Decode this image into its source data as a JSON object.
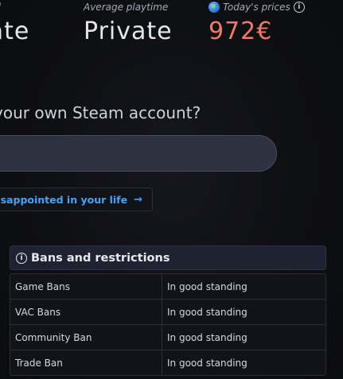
{
  "stats": {
    "record_label": "record",
    "record_value": "vate",
    "playtime_label": "Average playtime",
    "playtime_value": "Private",
    "prices_label": "Today's prices",
    "prices_value": "972€",
    "info_glyph": "i"
  },
  "steam_prompt": {
    "question": "your own Steam account?",
    "input_placeholder": ""
  },
  "link_button": {
    "label": "disappointed in your life",
    "arrow": "→"
  },
  "bans": {
    "title": "Bans and restrictions",
    "info_glyph": "i",
    "rows": [
      {
        "name": "Game Bans",
        "status": "In good standing"
      },
      {
        "name": "VAC Bans",
        "status": "In good standing"
      },
      {
        "name": "Community Ban",
        "status": "In good standing"
      },
      {
        "name": "Trade Ban",
        "status": "In good standing"
      }
    ]
  },
  "colors": {
    "price": "#f07a62",
    "link": "#3da5ff",
    "background": "#0c0d11"
  },
  "icons": {
    "globe": "globe-icon",
    "info": "info-icon",
    "arrow": "arrow-right-icon"
  }
}
